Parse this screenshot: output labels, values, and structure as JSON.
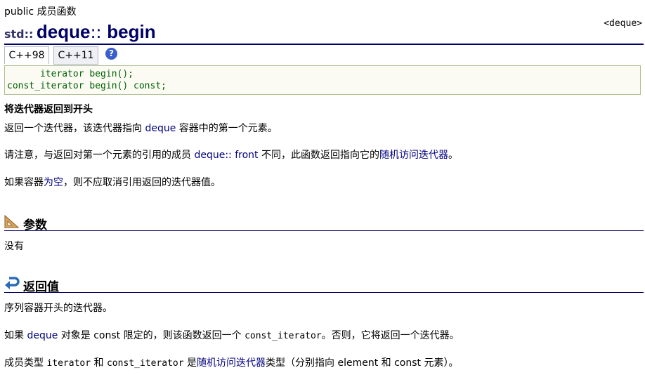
{
  "kind": "public 成员函数",
  "header_tag": "<deque>",
  "title": {
    "ns": "std::",
    "name": "deque",
    "sep": ":: ",
    "member": "begin"
  },
  "tabs": [
    "C++98",
    "C++11"
  ],
  "help_icon": "?",
  "code": [
    "      iterator begin();",
    "const_iterator begin() const;"
  ],
  "subtitle": "将迭代器返回到开头",
  "para1": {
    "a": "返回一个迭代器，该迭代器指向 ",
    "link": "deque",
    "b": " 容器中的第一个元素。"
  },
  "para2": {
    "a": "请注意，与返回对第一个元素的引用的成员 ",
    "link": "deque:: front",
    "b": " 不同，此函数返回指向它的",
    "link2": "随机访问迭代器",
    "c": "。"
  },
  "para3": {
    "a": "如果容器",
    "link": "为空",
    "b": "，则不应取消引用返回的迭代器值。"
  },
  "section_params": {
    "title": "参数",
    "icon": "ruler-icon"
  },
  "params_text": "没有",
  "section_return": {
    "title": "返回值",
    "icon": "return-arrow-icon"
  },
  "ret1": "序列容器开头的迭代器。",
  "ret2": {
    "a": "如果 ",
    "link": "deque",
    "b": " 对象是 const 限定的，则该函数返回一个 ",
    "code": "const_iterator",
    "c": "。否则，它将返回一个迭代器。"
  },
  "ret3": {
    "a": "成员类型 ",
    "code1": "iterator",
    "b": " 和 ",
    "code2": "const_iterator",
    "c": " 是",
    "link": "随机访问迭代器",
    "d": "类型（分别指向 element 和 const 元素）。"
  },
  "colors": {
    "title": "#000066",
    "link": "#000080",
    "code": "#006000"
  }
}
